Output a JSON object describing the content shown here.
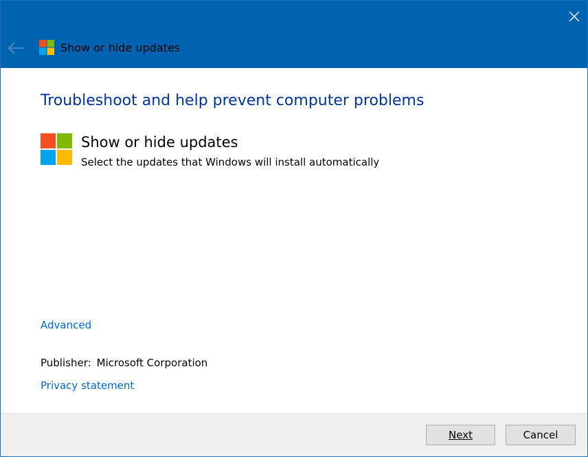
{
  "window": {
    "title": "Show or hide updates"
  },
  "main": {
    "heading": "Troubleshoot and help prevent computer problems",
    "tool_name": "Show or hide updates",
    "tool_description": "Select the updates that Windows will install automatically",
    "advanced_label": "Advanced",
    "publisher_label": "Publisher:",
    "publisher_value": "Microsoft Corporation",
    "privacy_label": "Privacy statement"
  },
  "footer": {
    "next_label": "Next",
    "cancel_label": "Cancel"
  },
  "icons": {
    "close": "close-icon",
    "back": "back-arrow-icon",
    "logo": "windows-logo-icon"
  },
  "colors": {
    "titlebar": "#0063b1",
    "heading": "#003399",
    "link": "#0066cc",
    "footer": "#f0f0f0",
    "logo_red": "#f25022",
    "logo_green": "#7fba00",
    "logo_blue": "#00a4ef",
    "logo_yellow": "#ffb900"
  }
}
